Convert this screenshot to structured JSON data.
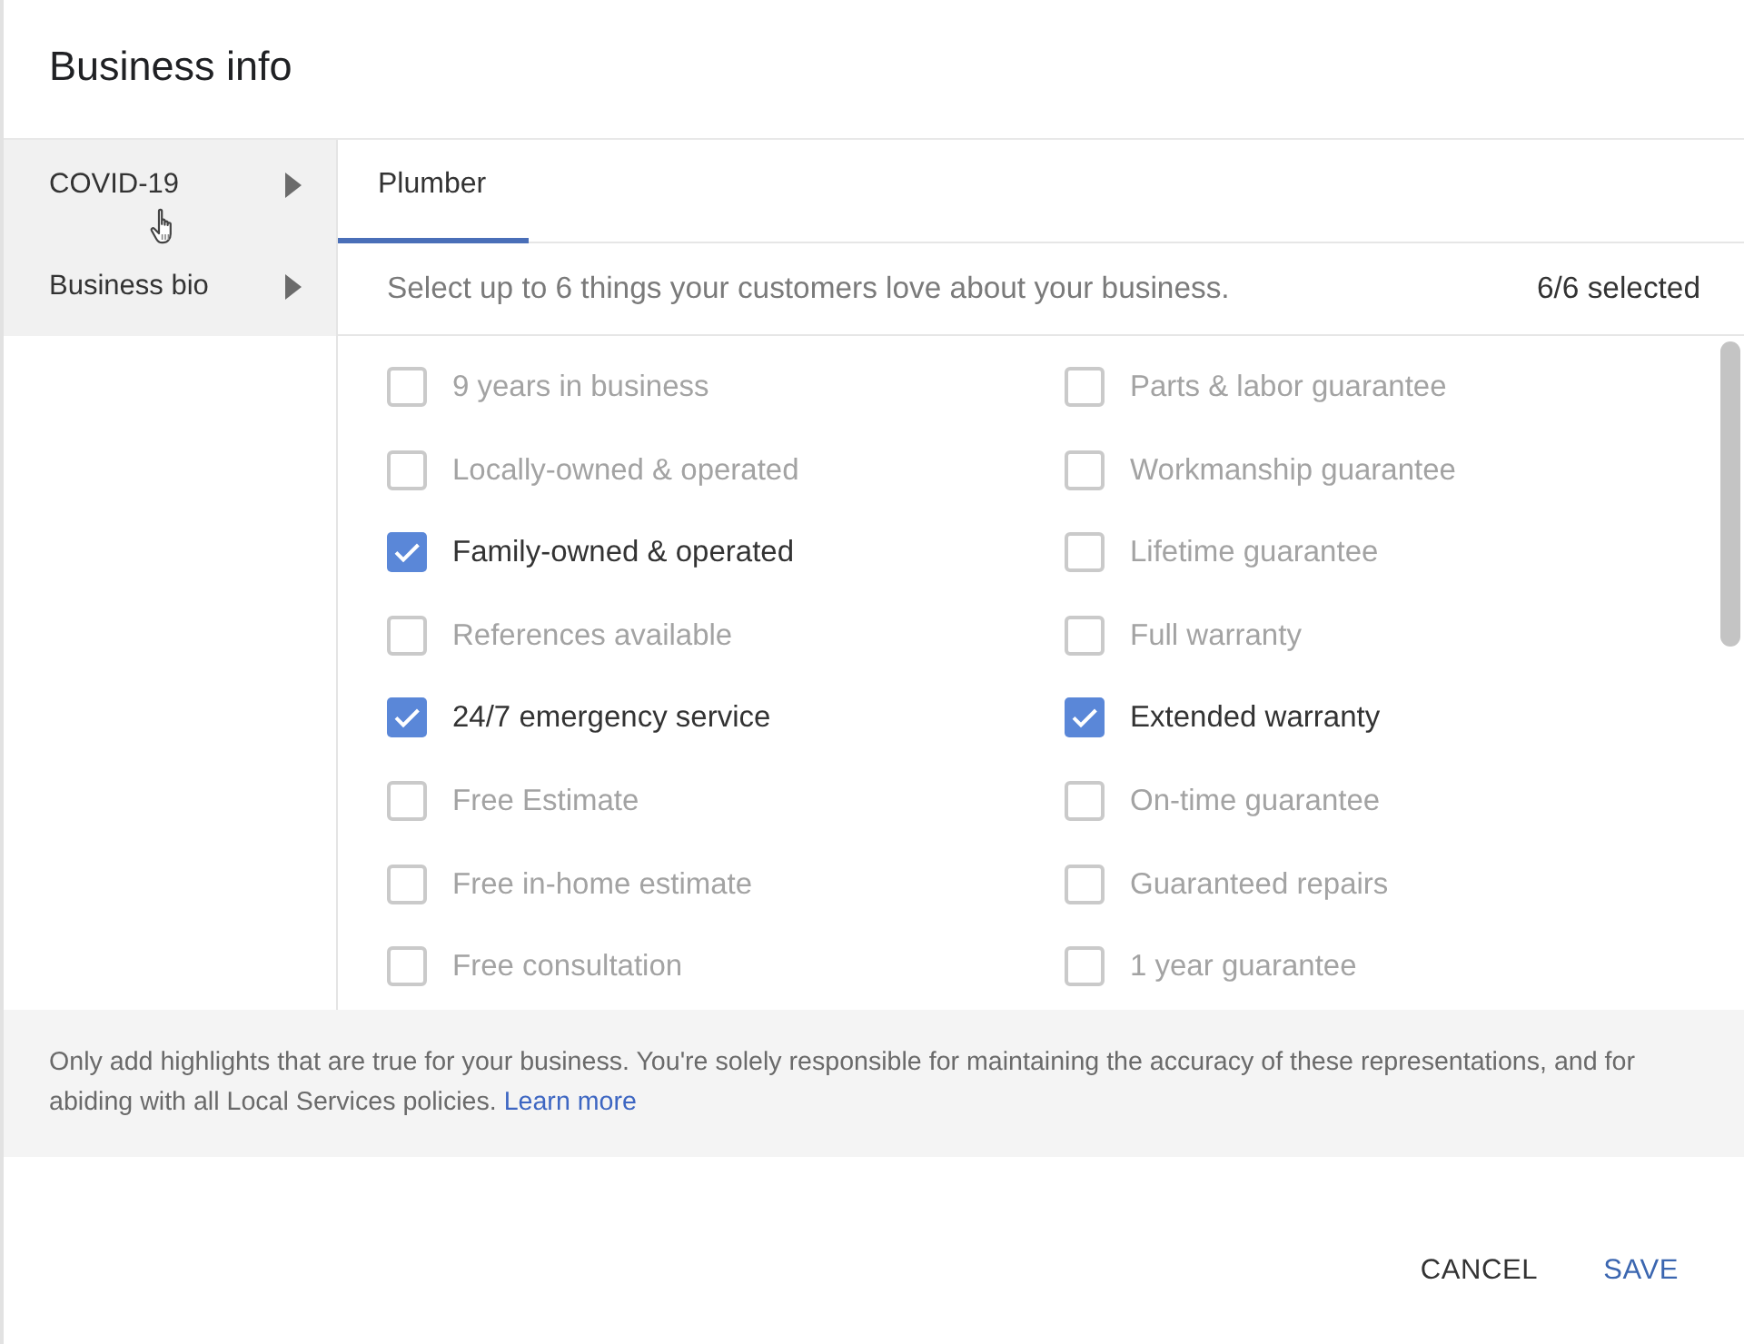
{
  "dialog": {
    "title": "Business info"
  },
  "sidebar": {
    "items": [
      {
        "label": "COVID-19"
      },
      {
        "label": "Business bio"
      }
    ]
  },
  "tabs": [
    {
      "label": "Plumber",
      "selected": true
    }
  ],
  "instructions": {
    "text": "Select up to 6 things your customers love about your business.",
    "count": "6/6 selected"
  },
  "highlights": {
    "columns": [
      {
        "items": [
          {
            "label": "9 years in business",
            "checked": false,
            "disabled": true
          },
          {
            "label": "Locally-owned & operated",
            "checked": false,
            "disabled": true
          },
          {
            "label": "Family-owned & operated",
            "checked": true,
            "disabled": false
          },
          {
            "label": "References available",
            "checked": false,
            "disabled": true
          },
          {
            "label": "24/7 emergency service",
            "checked": true,
            "disabled": false
          },
          {
            "label": "Free Estimate",
            "checked": false,
            "disabled": true
          },
          {
            "label": "Free in-home estimate",
            "checked": false,
            "disabled": true
          },
          {
            "label": "Free consultation",
            "checked": false,
            "disabled": true
          }
        ]
      },
      {
        "items": [
          {
            "label": "Parts & labor guarantee",
            "checked": false,
            "disabled": true
          },
          {
            "label": "Workmanship guarantee",
            "checked": false,
            "disabled": true
          },
          {
            "label": "Lifetime guarantee",
            "checked": false,
            "disabled": true
          },
          {
            "label": "Full warranty",
            "checked": false,
            "disabled": true
          },
          {
            "label": "Extended warranty",
            "checked": true,
            "disabled": false
          },
          {
            "label": "On-time guarantee",
            "checked": false,
            "disabled": true
          },
          {
            "label": "Guaranteed repairs",
            "checked": false,
            "disabled": true
          },
          {
            "label": "1 year guarantee",
            "checked": false,
            "disabled": true
          }
        ]
      }
    ]
  },
  "notice": {
    "text": "Only add highlights that are true for your business. You're solely responsible for maintaining the accuracy of these representations, and for abiding with all Local Services policies.",
    "link": "Learn more"
  },
  "buttons": [
    {
      "label": "CANCEL",
      "kind": "secondary"
    },
    {
      "label": "SAVE",
      "kind": "primary"
    }
  ]
}
